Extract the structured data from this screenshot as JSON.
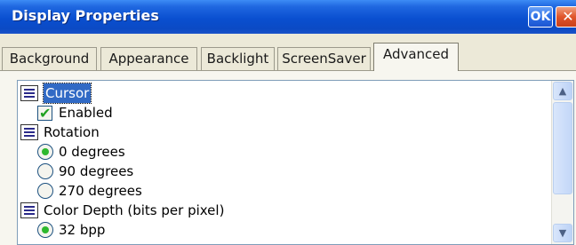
{
  "window": {
    "title": "Display Properties",
    "ok_label": "OK",
    "close_label": "✕"
  },
  "tabs": [
    {
      "label": "Background",
      "active": false
    },
    {
      "label": "Appearance",
      "active": false
    },
    {
      "label": "Backlight",
      "active": false
    },
    {
      "label": "ScreenSaver",
      "active": false
    },
    {
      "label": "Advanced",
      "active": true
    }
  ],
  "settings": {
    "cursor": {
      "label": "Cursor",
      "enabled_label": "Enabled",
      "enabled": true
    },
    "rotation": {
      "label": "Rotation",
      "options": [
        {
          "label": "0 degrees",
          "selected": true
        },
        {
          "label": "90 degrees",
          "selected": false
        },
        {
          "label": "270 degrees",
          "selected": false
        }
      ]
    },
    "color_depth": {
      "label": "Color Depth (bits per pixel)",
      "options": [
        {
          "label": "32 bpp",
          "selected": true
        }
      ]
    }
  },
  "scrollbar": {
    "up_icon": "▲",
    "down_icon": "▼"
  }
}
